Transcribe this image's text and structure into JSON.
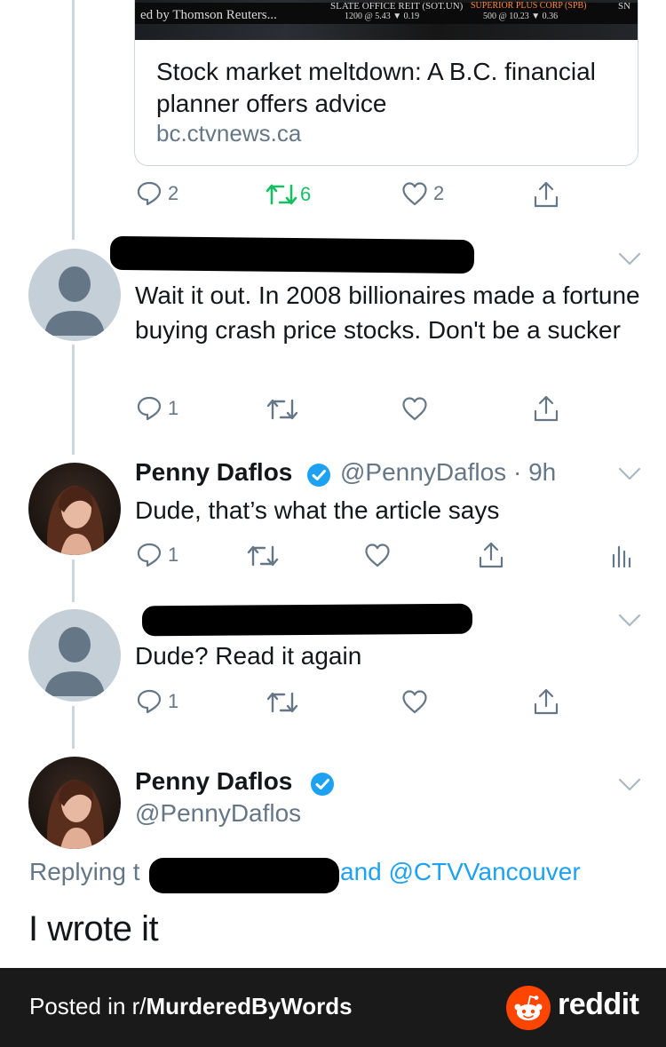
{
  "link_card": {
    "image_caption": "ed by Thomson Reuters...",
    "ticker_1_label": "SLATE OFFICE REIT (SOT.UN)",
    "ticker_1_values": "1200 @ 5.43 ▼ 0.19",
    "ticker_2_label": "SUPERIOR PLUS CORP (SPB)",
    "ticker_2_values": "500 @ 10.23 ▼ 0.36",
    "ticker_3_label": "SN",
    "title": "Stock market meltdown: A B.C. financial planner offers advice",
    "url": "bc.ctvnews.ca"
  },
  "card_actions": {
    "replies": "2",
    "retweets": "6",
    "likes": "2"
  },
  "tweets": [
    {
      "text": "Wait it out. In 2008 billionaires made a fortune buying crash price stocks. Don't be a sucker",
      "replies": "1"
    },
    {
      "name": "Penny Daflos",
      "handle_time": "@PennyDaflos · 9h",
      "text": "Dude, that’s what the article says",
      "replies": "1"
    },
    {
      "text": "Dude? Read it again",
      "replies": "1"
    }
  ],
  "main_tweet": {
    "name": "Penny Daflos",
    "handle": "@PennyDaflos",
    "replying_prefix": "Replying t",
    "replying_suffix": "and @CTVVancouver",
    "text": "I wrote it"
  },
  "footer": {
    "posted_in": "Posted in r/",
    "subreddit": "MurderedByWords",
    "brand": "reddit"
  },
  "colors": {
    "verified": "#1da1f2",
    "retweet_active": "#17bf63",
    "muted": "#657786",
    "mention": "#1da1f2",
    "footer_bg": "#1a1a1b",
    "reddit_orange": "#ff4500"
  }
}
